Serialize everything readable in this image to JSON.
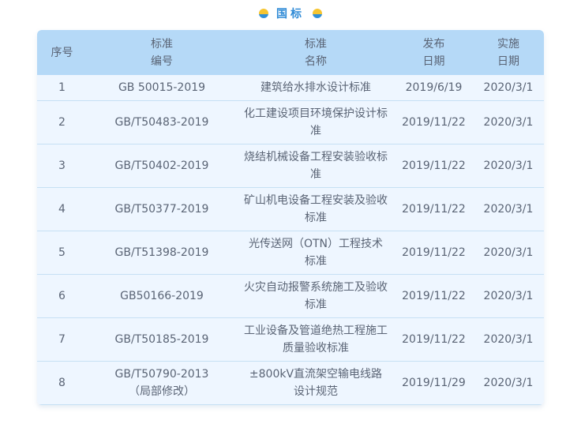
{
  "title": "国标",
  "header": {
    "no": "序号",
    "code_1": "标准",
    "code_2": "编号",
    "name_1": "标准",
    "name_2": "名称",
    "pub_1": "发布",
    "pub_2": "日期",
    "impl_1": "实施",
    "impl_2": "日期"
  },
  "rows": [
    {
      "no": "1",
      "code": "GB 50015-2019",
      "code_note": "",
      "name": "建筑给水排水设计标准",
      "pub": "2019/6/19",
      "impl": "2020/3/1"
    },
    {
      "no": "2",
      "code": "GB/T50483-2019",
      "code_note": "",
      "name": "化工建设项目环境保护设计标准",
      "pub": "2019/11/22",
      "impl": "2020/3/1"
    },
    {
      "no": "3",
      "code": "GB/T50402-2019",
      "code_note": "",
      "name": "烧结机械设备工程安装验收标准",
      "pub": "2019/11/22",
      "impl": "2020/3/1"
    },
    {
      "no": "4",
      "code": "GB/T50377-2019",
      "code_note": "",
      "name": "矿山机电设备工程安装及验收标准",
      "pub": "2019/11/22",
      "impl": "2020/3/1"
    },
    {
      "no": "5",
      "code": "GB/T51398-2019",
      "code_note": "",
      "name": "光传送网（OTN）工程技术标准",
      "pub": "2019/11/22",
      "impl": "2020/3/1"
    },
    {
      "no": "6",
      "code": "GB50166-2019",
      "code_note": "",
      "name": "火灾自动报警系统施工及验收标准",
      "pub": "2019/11/22",
      "impl": "2020/3/1"
    },
    {
      "no": "7",
      "code": "GB/T50185-2019",
      "code_note": "",
      "name": "工业设备及管道绝热工程施工质量验收标准",
      "pub": "2019/11/22",
      "impl": "2020/3/1"
    },
    {
      "no": "8",
      "code": "GB/T50790-2013",
      "code_note": "（局部修改）",
      "name": "±800kV直流架空输电线路设计规范",
      "pub": "2019/11/29",
      "impl": "2020/3/1"
    }
  ]
}
